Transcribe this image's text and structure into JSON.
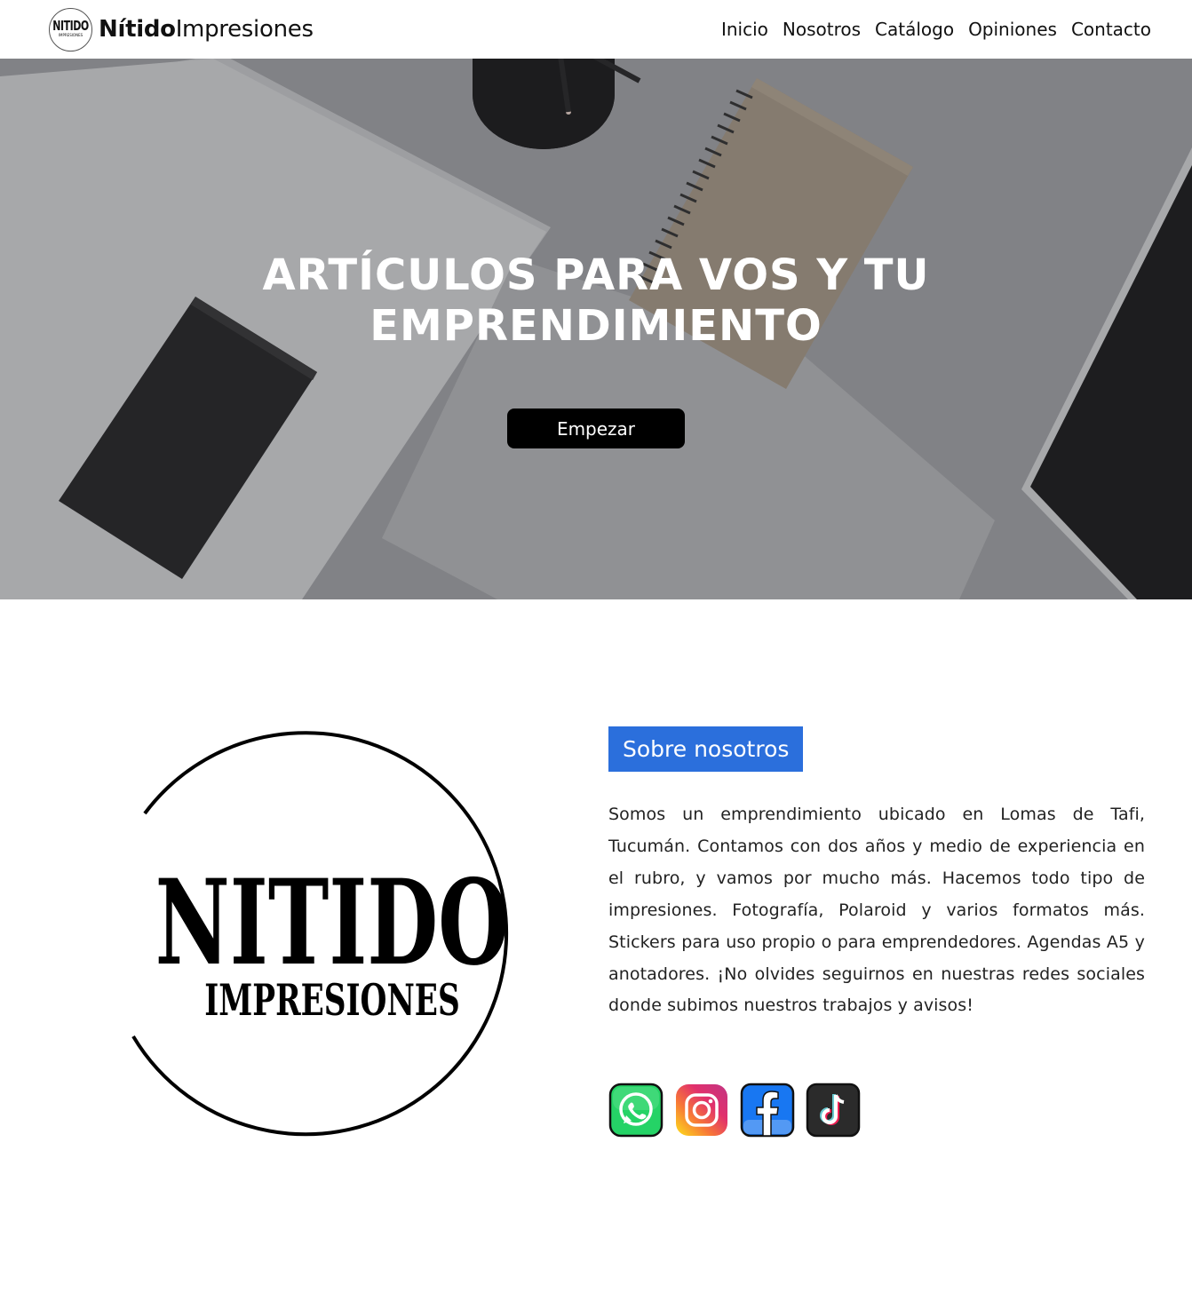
{
  "header": {
    "brand_mark_top": "NITIDO",
    "brand_mark_bottom": "IMPRESIONES",
    "brand_bold": "Nítido",
    "brand_light": "Impresiones",
    "nav": [
      "Inicio",
      "Nosotros",
      "Catálogo",
      "Opiniones",
      "Contacto"
    ]
  },
  "hero": {
    "title_line1": "ARTÍCULOS PARA VOS Y TU",
    "title_line2": "EMPRENDIMIENTO",
    "button_label": "Empezar"
  },
  "about": {
    "logo_title": "NITIDO",
    "logo_subtitle": "IMPRESIONES",
    "heading": "Sobre nosotros",
    "body": "Somos un emprendimiento ubicado en Lomas de Tafi, Tucumán. Contamos con dos años y medio de experiencia en el rubro, y vamos por mucho más. Hacemos todo tipo de impresiones. Fotografía, Polaroid y varios formatos más. Stickers para uso propio o para emprendedores. Agendas A5 y anotadores. ¡No olvides seguirnos en nuestras redes sociales donde subimos nuestros trabajos y avisos!",
    "social": [
      {
        "icon": "whatsapp-icon",
        "color": "#25d366"
      },
      {
        "icon": "instagram-icon",
        "color": "#e1306c"
      },
      {
        "icon": "facebook-icon",
        "color": "#1877f2"
      },
      {
        "icon": "tiktok-icon",
        "color": "#2b2b2b"
      }
    ]
  },
  "colors": {
    "accent": "#2b6fdc",
    "button": "#000000",
    "hero_overlay": "#6f7073"
  }
}
